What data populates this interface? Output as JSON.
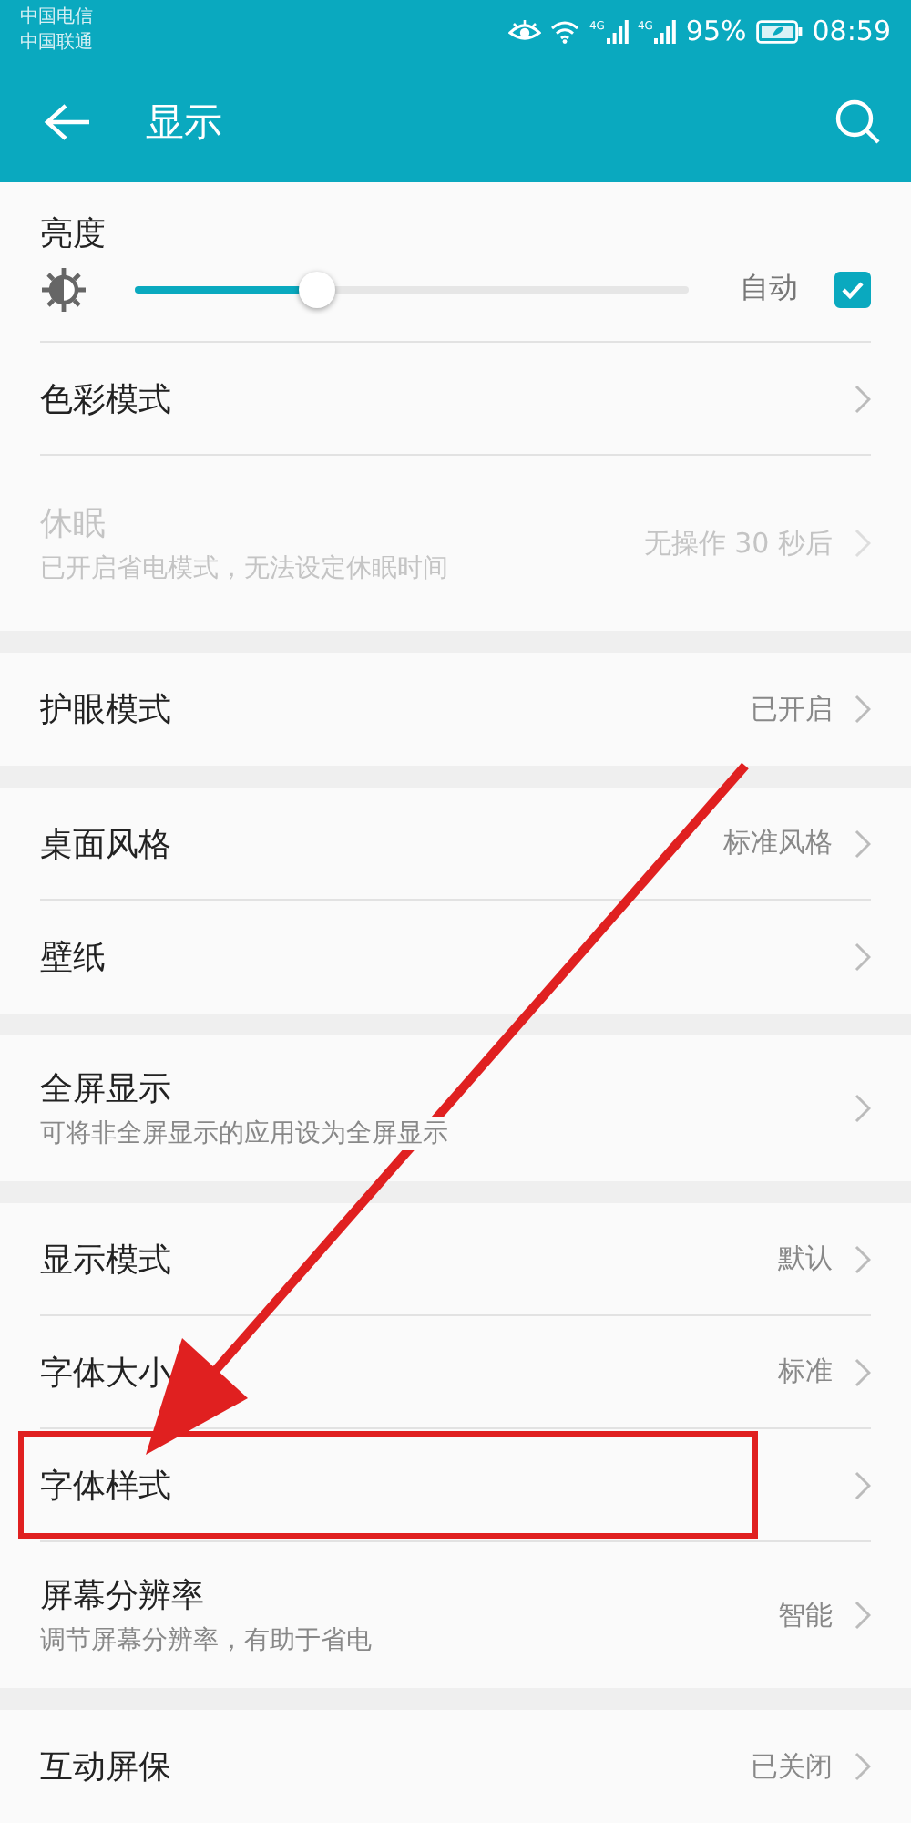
{
  "status_bar": {
    "carriers": [
      "中国电信",
      "中国联通"
    ],
    "network_labels": [
      "4G",
      "4G"
    ],
    "battery": "95%",
    "time": "08:59"
  },
  "header": {
    "title": "显示"
  },
  "sections": [
    [
      {
        "kind": "slider",
        "title": "亮度",
        "level": 0.33,
        "auto_label": "自动",
        "checked": true
      },
      {
        "kind": "nav",
        "title": "色彩模式",
        "disabled": false,
        "highlighted": false
      },
      {
        "kind": "nav",
        "title": "休眠",
        "subtitle": "已开启省电模式，无法设定休眠时间",
        "value": "无操作 30 秒后",
        "disabled": true,
        "highlighted": false
      }
    ],
    [
      {
        "kind": "nav",
        "title": "护眼模式",
        "value": "已开启",
        "disabled": false,
        "highlighted": false
      }
    ],
    [
      {
        "kind": "nav",
        "title": "桌面风格",
        "value": "标准风格",
        "disabled": false,
        "highlighted": false
      },
      {
        "kind": "nav",
        "title": "壁纸",
        "disabled": false,
        "highlighted": false
      }
    ],
    [
      {
        "kind": "nav",
        "title": "全屏显示",
        "subtitle": "可将非全屏显示的应用设为全屏显示",
        "disabled": false,
        "highlighted": false
      }
    ],
    [
      {
        "kind": "nav",
        "title": "显示模式",
        "value": "默认",
        "disabled": false,
        "highlighted": false
      },
      {
        "kind": "nav",
        "title": "字体大小",
        "value": "标准",
        "disabled": false,
        "highlighted": false
      },
      {
        "kind": "nav",
        "title": "字体样式",
        "disabled": false,
        "highlighted": true
      },
      {
        "kind": "nav",
        "title": "屏幕分辨率",
        "subtitle": "调节屏幕分辨率，有助于省电",
        "value": "智能",
        "disabled": false,
        "highlighted": false
      }
    ],
    [
      {
        "kind": "nav",
        "title": "互动屏保",
        "value": "已关闭",
        "disabled": false,
        "highlighted": false
      }
    ]
  ]
}
